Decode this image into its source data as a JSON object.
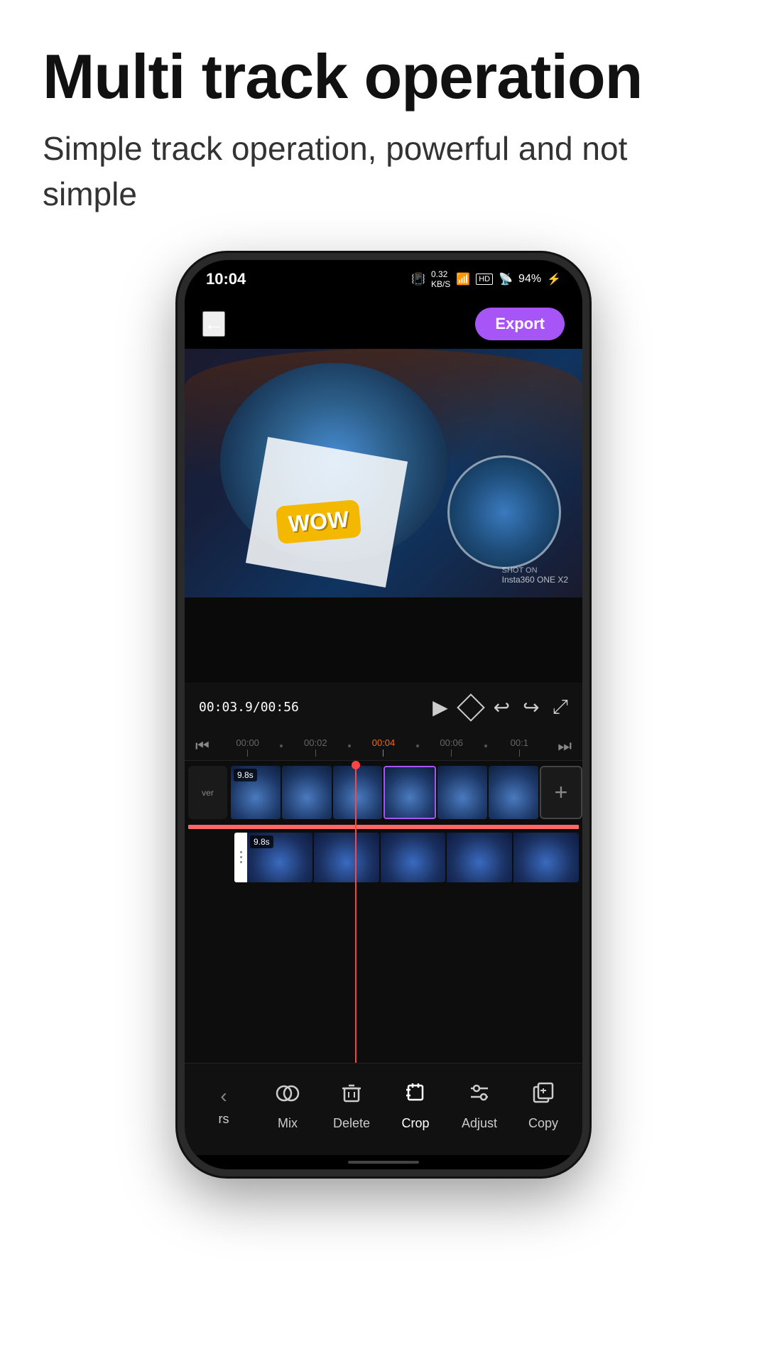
{
  "page": {
    "title": "Multi track operation",
    "subtitle": "Simple track operation, powerful and not simple"
  },
  "status_bar": {
    "time": "10:04",
    "data_speed": "0.32\nKB/S",
    "battery": "94%"
  },
  "app_header": {
    "back_label": "←",
    "export_label": "Export"
  },
  "video_preview": {
    "wow_text": "WOW",
    "watermark": "SHOT ON",
    "brand": "Insta360 ONE X2"
  },
  "timeline": {
    "current_time": "00:03.9/00:56",
    "ruler_marks": [
      "00:00",
      "00:02",
      "00:04",
      "00:06",
      "00:1"
    ],
    "track1_duration": "9.8s",
    "track2_duration": "9.8s"
  },
  "toolbar": {
    "items": [
      {
        "id": "back",
        "label": "rs",
        "icon": ")"
      },
      {
        "id": "mix",
        "label": "Mix",
        "icon": "⊙"
      },
      {
        "id": "delete",
        "label": "Delete",
        "icon": "🗑"
      },
      {
        "id": "crop",
        "label": "Crop",
        "icon": "⤢"
      },
      {
        "id": "adjust",
        "label": "Adjust",
        "icon": "⚙"
      },
      {
        "id": "copy",
        "label": "Copy",
        "icon": "⊞"
      }
    ]
  }
}
